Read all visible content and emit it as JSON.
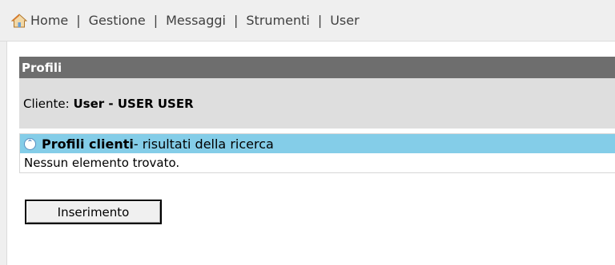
{
  "nav": {
    "items": [
      {
        "label": "Home",
        "icon": "home-icon"
      },
      {
        "label": "Gestione"
      },
      {
        "label": "Messaggi"
      },
      {
        "label": "Strumenti"
      },
      {
        "label": "User"
      }
    ],
    "separator": "|"
  },
  "panel": {
    "title": "Profili",
    "client_label": "Cliente:",
    "client_value": "User - USER USER"
  },
  "results": {
    "title": "Profili clienti",
    "subtitle": " - risultati della ricerca",
    "empty_text": "Nessun elemento trovato.",
    "collapse_icon": "chevron-double-up-icon"
  },
  "actions": {
    "insert_label": "Inserimento"
  },
  "colors": {
    "panel_header": "#6e6e6e",
    "client_row": "#dedede",
    "results_header": "#84cde8"
  }
}
